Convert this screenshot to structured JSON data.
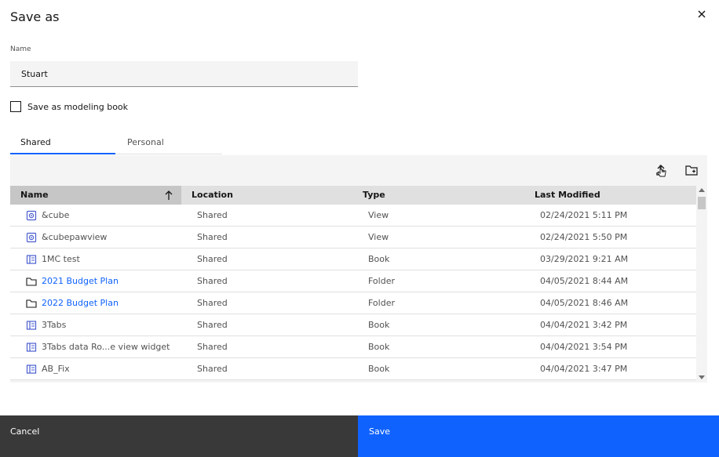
{
  "dialog": {
    "title": "Save as",
    "name_label": "Name",
    "name_value": "Stuart",
    "checkbox_label": "Save as modeling book",
    "checkbox_checked": false
  },
  "tabs": [
    {
      "label": "Shared",
      "active": true
    },
    {
      "label": "Personal",
      "active": false
    }
  ],
  "toolbar": {
    "upload_icon": "upload-icon",
    "new_folder_icon": "new-folder-icon"
  },
  "table": {
    "headers": {
      "name": "Name",
      "location": "Location",
      "type": "Type",
      "modified": "Last Modified"
    },
    "sort": "ascending",
    "rows": [
      {
        "icon": "view-icon",
        "name": "&cube",
        "location": "Shared",
        "type": "View",
        "modified": "02/24/2021 5:11 PM",
        "link": false
      },
      {
        "icon": "view-icon",
        "name": "&cubepawview",
        "location": "Shared",
        "type": "View",
        "modified": "02/24/2021 5:50 PM",
        "link": false
      },
      {
        "icon": "book-icon",
        "name": "1MC test",
        "location": "Shared",
        "type": "Book",
        "modified": "03/29/2021 9:21 AM",
        "link": false
      },
      {
        "icon": "folder-icon",
        "name": "2021 Budget Plan",
        "location": "Shared",
        "type": "Folder",
        "modified": "04/05/2021 8:44 AM",
        "link": true
      },
      {
        "icon": "folder-icon",
        "name": "2022 Budget Plan",
        "location": "Shared",
        "type": "Folder",
        "modified": "04/05/2021 8:46 AM",
        "link": true
      },
      {
        "icon": "book-icon",
        "name": "3Tabs",
        "location": "Shared",
        "type": "Book",
        "modified": "04/04/2021 3:42 PM",
        "link": false
      },
      {
        "icon": "book-icon",
        "name": "3Tabs data Ro...e view widget",
        "location": "Shared",
        "type": "Book",
        "modified": "04/04/2021 3:54 PM",
        "link": false
      },
      {
        "icon": "book-icon",
        "name": "AB_Fix",
        "location": "Shared",
        "type": "Book",
        "modified": "04/04/2021 3:47 PM",
        "link": false
      }
    ]
  },
  "footer": {
    "cancel_label": "Cancel",
    "save_label": "Save"
  },
  "colors": {
    "primary": "#0f62fe",
    "secondary": "#393939",
    "link": "#0f62fe",
    "icon": "#4a5fd0"
  }
}
